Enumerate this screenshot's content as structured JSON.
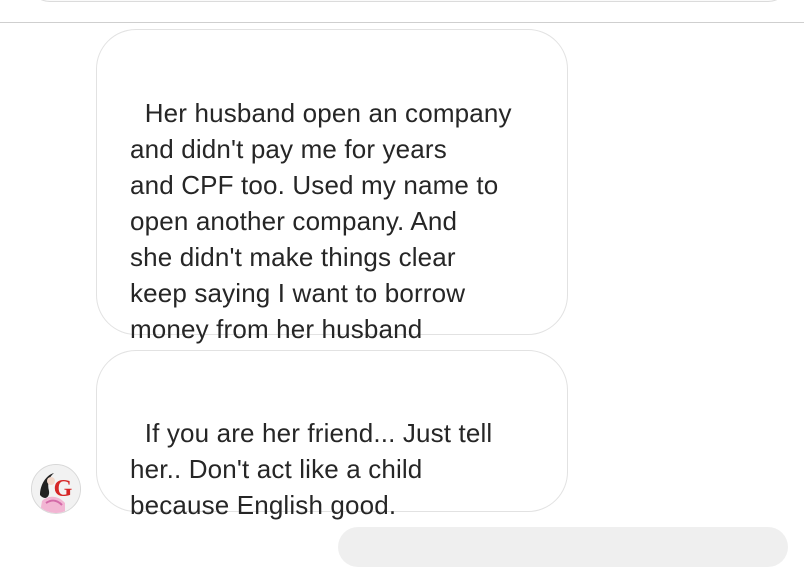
{
  "messages": [
    {
      "text": "Her husband open an company\nand didn't pay me for years\nand CPF too. Used my name to\nopen another company. And\nshe didn't make things clear\nkeep saying I want to borrow\nmoney from her husband"
    },
    {
      "text": "If you are her friend... Just tell\nher.. Don't act like a child\nbecause English good."
    }
  ],
  "avatar": {
    "icon": "profile-avatar-icon",
    "letter": "G"
  },
  "colors": {
    "bubble_border": "#e2e2e2",
    "text": "#262626",
    "outgoing_bubble": "#efefef"
  }
}
